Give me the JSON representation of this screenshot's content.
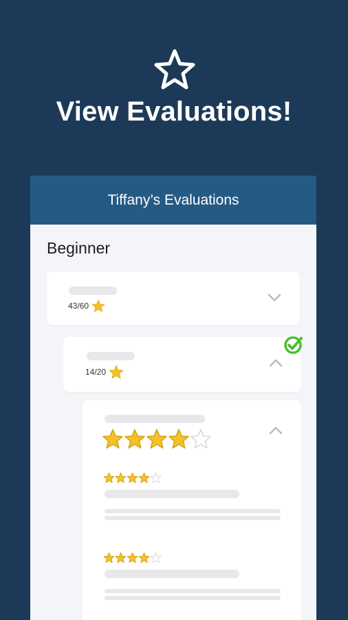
{
  "hero": {
    "title": "View Evaluations!",
    "icon": "star-outline-icon"
  },
  "screen": {
    "header_title": "Tiffany’s Evaluations",
    "section_title": "Beginner",
    "cards": [
      {
        "score": "43/60",
        "expanded": false
      },
      {
        "score": "14/20",
        "expanded": true,
        "completed": true
      },
      {
        "rating": 4,
        "max_rating": 5,
        "expanded": true,
        "reviews": [
          {
            "rating": 4,
            "max_rating": 5
          },
          {
            "rating": 4,
            "max_rating": 5
          }
        ]
      }
    ]
  },
  "colors": {
    "background": "#1c3a57",
    "header": "#255a84",
    "star": "#f3c22b",
    "check": "#4bbf2f"
  }
}
